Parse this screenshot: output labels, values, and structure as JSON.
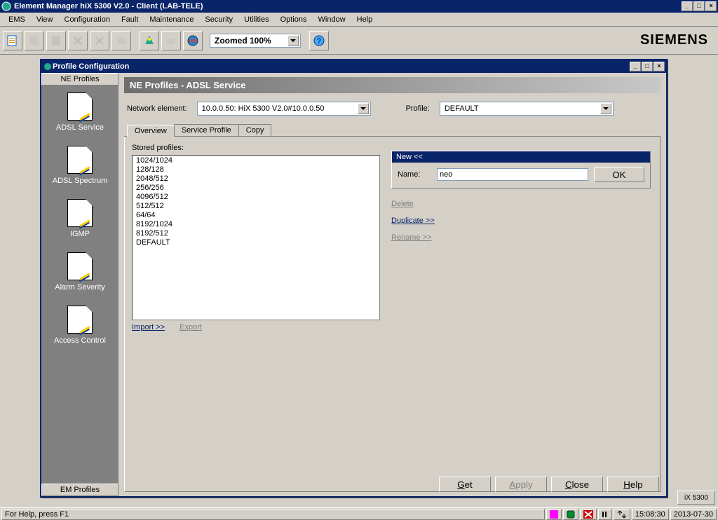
{
  "app": {
    "title": "Element Manager hiX 5300 V2.0 - Client (LAB-TELE)",
    "brand": "SIEMENS"
  },
  "menu": [
    "EMS",
    "View",
    "Configuration",
    "Fault",
    "Maintenance",
    "Security",
    "Utilities",
    "Options",
    "Window",
    "Help"
  ],
  "toolbar": {
    "zoom": "Zoomed 100%"
  },
  "inner_window": {
    "title": "Profile Configuration"
  },
  "sidebar": {
    "header": "NE Profiles",
    "items": [
      "ADSL Service",
      "ADSL Spectrum",
      "IGMP",
      "Alarm Severity",
      "Access Control"
    ],
    "footer": "EM Profiles"
  },
  "section": {
    "heading": "NE Profiles - ADSL Service",
    "ne_label": "Network element:",
    "ne_value": "10.0.0.50: HiX 5300 V2.0#10.0.0.50",
    "profile_label": "Profile:",
    "profile_value": "DEFAULT"
  },
  "tabs": [
    "Overview",
    "Service Profile",
    "Copy"
  ],
  "overview": {
    "stored_label": "Stored profiles:",
    "profiles": [
      "1024/1024",
      "128/128",
      "2048/512",
      "256/256",
      "4096/512",
      "512/512",
      "64/64",
      "8192/1024",
      "8192/512",
      "DEFAULT"
    ],
    "import": "Import >>",
    "export": "Export",
    "new_header": "New <<",
    "name_label": "Name:",
    "name_value": "neo",
    "ok": "OK",
    "delete": "Delete",
    "duplicate": "Duplicate >>",
    "rename": "Rename >>"
  },
  "buttons": {
    "get": "Get",
    "apply": "Apply",
    "close": "Close",
    "help": "Help"
  },
  "dock_label": "iX 5300",
  "status": {
    "help": "For Help, press F1",
    "time": "15:08:30",
    "date": "2013-07-30"
  }
}
